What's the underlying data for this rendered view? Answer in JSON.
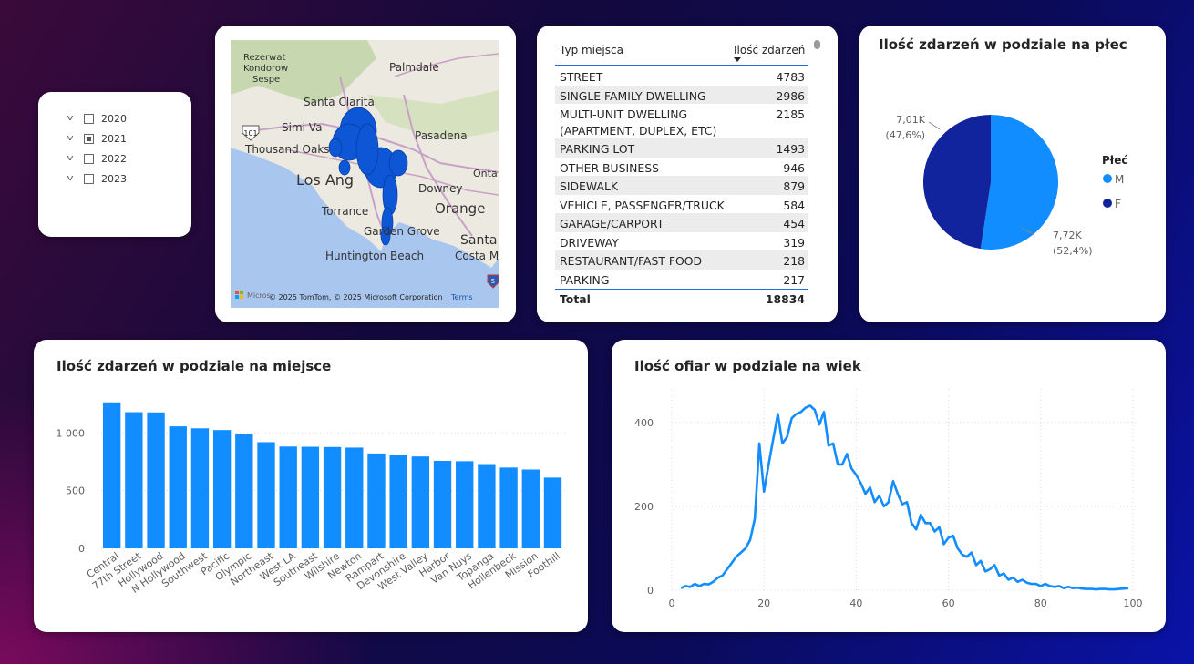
{
  "slicer": {
    "years": [
      {
        "label": "2020",
        "state": "unchecked"
      },
      {
        "label": "2021",
        "state": "partial"
      },
      {
        "label": "2022",
        "state": "unchecked"
      },
      {
        "label": "2023",
        "state": "unchecked"
      }
    ]
  },
  "map": {
    "labels": [
      "Rezerwat",
      "Kondorow",
      "Sespe",
      "Palmdale",
      "Santa Clarita",
      "Simi Va",
      "Thousand Oaks",
      "Pasadena",
      "Onta",
      "Los Ang",
      "Downey",
      "Orange",
      "Torrance",
      "Garden Grove",
      "Santa",
      "Huntington Beach",
      "Costa M"
    ],
    "highway_shields": [
      "101",
      "5"
    ],
    "attribution": "© 2025 TomTom, © 2025 Microsoft Corporation",
    "terms": "Terms",
    "brand": "Micros"
  },
  "table": {
    "col1": "Typ miejsca",
    "col2": "Ilość zdarzeń",
    "rows": [
      {
        "name": "STREET",
        "count": "4783"
      },
      {
        "name": "SINGLE FAMILY DWELLING",
        "count": "2986"
      },
      {
        "name": "MULTI-UNIT DWELLING",
        "name2": "(APARTMENT, DUPLEX, ETC)",
        "count": "2185"
      },
      {
        "name": "PARKING LOT",
        "count": "1493"
      },
      {
        "name": "OTHER BUSINESS",
        "count": "946"
      },
      {
        "name": "SIDEWALK",
        "count": "879"
      },
      {
        "name": "VEHICLE, PASSENGER/TRUCK",
        "count": "584"
      },
      {
        "name": "GARAGE/CARPORT",
        "count": "454"
      },
      {
        "name": "DRIVEWAY",
        "count": "319"
      },
      {
        "name": "RESTAURANT/FAST FOOD",
        "count": "218"
      },
      {
        "name": "PARKING",
        "count": "217"
      }
    ],
    "total_label": "Total",
    "total_value": "18834"
  },
  "pie": {
    "title": "Ilość zdarzeń w podziale na płec",
    "legend_title": "Płeć",
    "m_label": "7,72K",
    "m_pct": "(52,4%)",
    "f_label": "7,01K",
    "f_pct": "(47,6%)"
  },
  "bar": {
    "title": "Ilość zdarzeń w podziale na miejsce"
  },
  "age": {
    "title": "Ilość ofiar w podziale na wiek"
  },
  "colors": {
    "bar": "#118dff",
    "pie_m": "#118dff",
    "pie_f": "#12239e",
    "line": "#118dff"
  },
  "chart_data": [
    {
      "type": "pie",
      "title": "Ilość zdarzeń w podziale na płec",
      "legend_title": "Płeć",
      "categories": [
        "M",
        "F"
      ],
      "values": [
        7720,
        7010
      ],
      "labels": [
        "7,72K (52,4%)",
        "7,01K (47,6%)"
      ],
      "legend_position": "right"
    },
    {
      "type": "bar",
      "title": "Ilość zdarzeń w podziale na miejsce",
      "categories": [
        "Central",
        "77th Street",
        "Hollywood",
        "N Hollywood",
        "Southwest",
        "Pacific",
        "Olympic",
        "Northeast",
        "West LA",
        "Southeast",
        "Wilshire",
        "Newton",
        "Rampart",
        "Devonshire",
        "West Valley",
        "Harbor",
        "Van Nuys",
        "Topanga",
        "Hollenbeck",
        "Mission",
        "Foothill"
      ],
      "values": [
        1265,
        1180,
        1178,
        1057,
        1040,
        1025,
        993,
        920,
        882,
        880,
        878,
        873,
        822,
        810,
        796,
        758,
        755,
        730,
        700,
        683,
        613
      ],
      "yticks": [
        0,
        500,
        1000
      ],
      "ytick_labels": [
        "0",
        "500",
        "1 000"
      ],
      "ylim": [
        0,
        1350
      ],
      "grid": true
    },
    {
      "type": "line",
      "title": "Ilość ofiar w podziale na wiek",
      "x": [
        2,
        3,
        4,
        5,
        6,
        7,
        8,
        9,
        10,
        11,
        12,
        13,
        14,
        15,
        16,
        17,
        18,
        19,
        20,
        21,
        22,
        23,
        24,
        25,
        26,
        27,
        28,
        29,
        30,
        31,
        32,
        33,
        34,
        35,
        36,
        37,
        38,
        39,
        40,
        41,
        42,
        43,
        44,
        45,
        46,
        47,
        48,
        49,
        50,
        51,
        52,
        53,
        54,
        55,
        56,
        57,
        58,
        59,
        60,
        61,
        62,
        63,
        64,
        65,
        66,
        67,
        68,
        69,
        70,
        71,
        72,
        73,
        74,
        75,
        76,
        77,
        78,
        79,
        80,
        81,
        82,
        83,
        84,
        85,
        86,
        87,
        88,
        89,
        90,
        91,
        92,
        93,
        94,
        95,
        96,
        97,
        98,
        99
      ],
      "y": [
        5,
        10,
        8,
        15,
        10,
        15,
        14,
        20,
        30,
        35,
        50,
        65,
        80,
        90,
        100,
        120,
        170,
        350,
        235,
        300,
        360,
        420,
        350,
        365,
        410,
        420,
        425,
        435,
        440,
        430,
        395,
        425,
        345,
        350,
        300,
        300,
        325,
        290,
        275,
        255,
        230,
        245,
        210,
        225,
        200,
        210,
        260,
        230,
        205,
        210,
        160,
        145,
        180,
        160,
        160,
        140,
        150,
        110,
        125,
        130,
        100,
        85,
        80,
        90,
        60,
        70,
        45,
        50,
        60,
        35,
        40,
        25,
        30,
        20,
        25,
        18,
        15,
        15,
        10,
        15,
        10,
        8,
        10,
        5,
        8,
        5,
        6,
        4,
        3,
        3,
        2,
        3,
        3,
        2,
        2,
        3,
        4,
        5
      ],
      "xticks": [
        0,
        20,
        40,
        60,
        80,
        100
      ],
      "yticks": [
        0,
        200,
        400
      ],
      "xlim": [
        0,
        100
      ],
      "ylim": [
        0,
        480
      ],
      "grid": true
    }
  ]
}
